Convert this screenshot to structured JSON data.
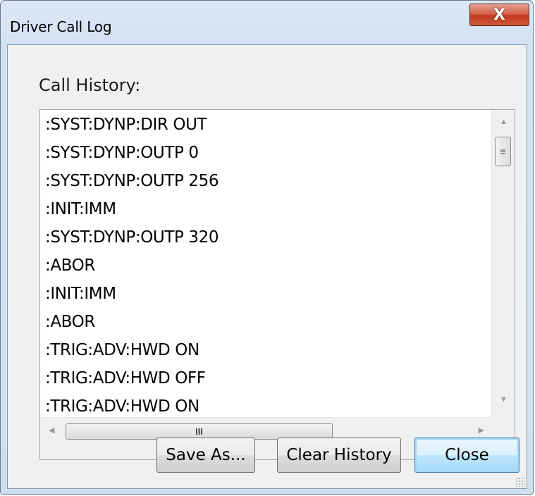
{
  "window": {
    "title": "Driver Call Log",
    "close_glyph": "X"
  },
  "main": {
    "heading": "Call History:",
    "history": [
      ":SYST:DYNP:DIR OUT",
      ":SYST:DYNP:OUTP 0",
      ":SYST:DYNP:OUTP 256",
      ":INIT:IMM",
      ":SYST:DYNP:OUTP 320",
      ":ABOR",
      ":INIT:IMM",
      ":ABOR",
      ":TRIG:ADV:HWD ON",
      ":TRIG:ADV:HWD OFF",
      ":TRIG:ADV:HWD ON"
    ],
    "vscroll_grip_glyph": "≡",
    "hscroll_grip_glyph": "III"
  },
  "buttons": {
    "save_as": "Save As...",
    "clear_history": "Clear History",
    "close": "Close"
  },
  "colors": {
    "close_button": "#c2391e",
    "default_button": "#a7d9f5"
  },
  "icons": [
    "close-icon",
    "scroll-up-arrow-icon",
    "scroll-down-arrow-icon",
    "scroll-left-arrow-icon",
    "scroll-right-arrow-icon",
    "resize-grip-icon"
  ]
}
